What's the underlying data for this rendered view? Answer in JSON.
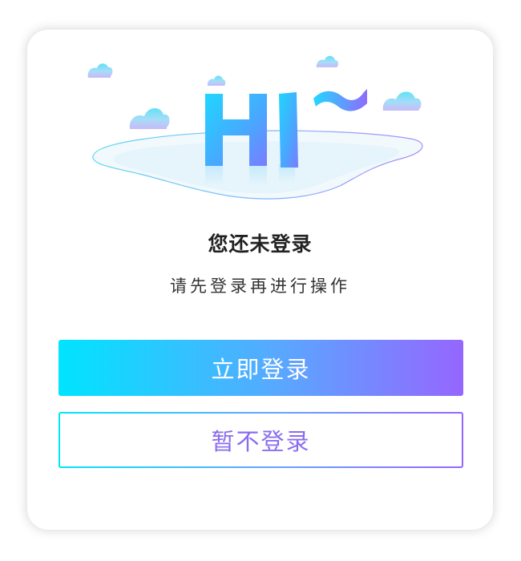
{
  "dialog": {
    "illustration_text": "HI~",
    "title": "您还未登录",
    "subtitle": "请先登录再进行操作",
    "primary_button": "立即登录",
    "secondary_button": "暂不登录"
  },
  "colors": {
    "gradient_start": "#00e4ff",
    "gradient_end": "#9566ff",
    "title": "#222222",
    "subtitle": "#333333",
    "secondary_text": "#8a6cf0"
  },
  "icons": {
    "illustration": "hi-lake-illustration",
    "clouds": "cloud-icon"
  }
}
